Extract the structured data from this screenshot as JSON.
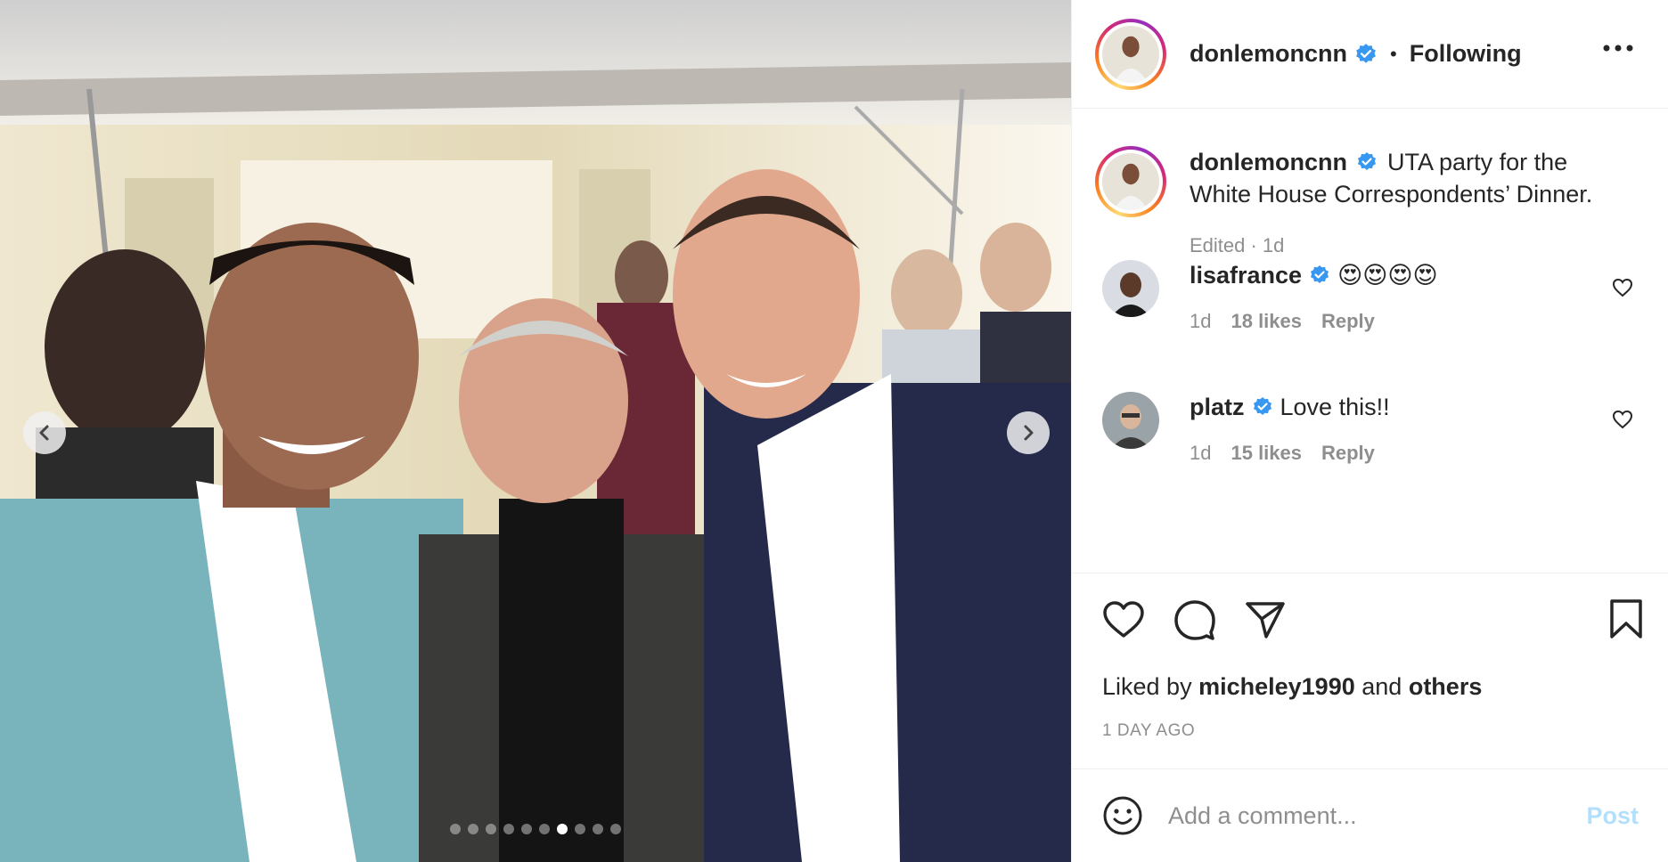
{
  "header": {
    "username": "donlemoncnn",
    "separator": "•",
    "follow_status": "Following",
    "more_icon": "more-horizontal-icon"
  },
  "caption": {
    "username": "donlemoncnn",
    "text": "UTA party for the White House Correspondents’ Dinner.",
    "meta": "Edited · 1d"
  },
  "comments": [
    {
      "username": "lisafrance",
      "text": "😍😍😍😍",
      "age": "1d",
      "likes": "18 likes",
      "reply": "Reply"
    },
    {
      "username": "platz",
      "text": "Love this!!",
      "age": "1d",
      "likes": "15 likes",
      "reply": "Reply"
    }
  ],
  "carousel": {
    "count": 10,
    "active": 6
  },
  "likes": {
    "prefix": "Liked by",
    "user": "micheley1990",
    "middle": "and",
    "others": "others"
  },
  "timestamp": "1 DAY AGO",
  "comment_box": {
    "placeholder": "Add a comment...",
    "post_label": "Post"
  },
  "colors": {
    "verified": "#3897f0",
    "muted": "#8e8e8e",
    "post_disabled": "#b2dffc"
  }
}
